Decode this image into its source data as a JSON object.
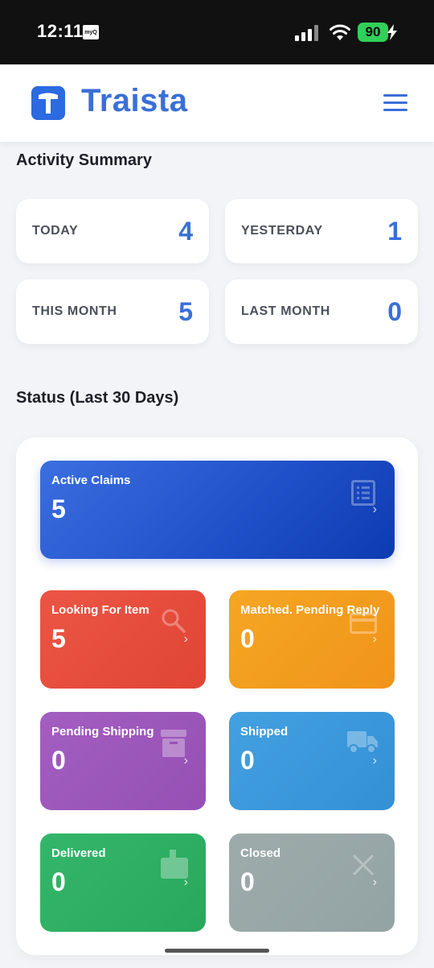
{
  "status_bar": {
    "time": "12:11",
    "app_badge": "myQ",
    "battery": "90"
  },
  "header": {
    "app_name": "Traista"
  },
  "activity": {
    "title": "Activity Summary",
    "cards": [
      {
        "label": "TODAY",
        "value": "4"
      },
      {
        "label": "YESTERDAY",
        "value": "1"
      },
      {
        "label": "THIS MONTH",
        "value": "5"
      },
      {
        "label": "LAST MONTH",
        "value": "0"
      }
    ]
  },
  "status": {
    "title": "Status (Last 30 Days)",
    "tiles": [
      {
        "label": "Active Claims",
        "count": "5",
        "icon": "list-icon",
        "color": "#2f5fd6"
      },
      {
        "label": "Looking For Item",
        "count": "5",
        "icon": "search-icon",
        "color": "#e84c3d"
      },
      {
        "label": "Matched. Pending Reply",
        "count": "0",
        "icon": "card-icon",
        "color": "#f39c1a"
      },
      {
        "label": "Pending Shipping",
        "count": "0",
        "icon": "box-icon",
        "color": "#9b59b6"
      },
      {
        "label": "Shipped",
        "count": "0",
        "icon": "truck-icon",
        "color": "#3498db"
      },
      {
        "label": "Delivered",
        "count": "0",
        "icon": "mailbox-icon",
        "color": "#27ae60"
      },
      {
        "label": "Closed",
        "count": "0",
        "icon": "close-icon",
        "color": "#95a5a6"
      }
    ]
  }
}
